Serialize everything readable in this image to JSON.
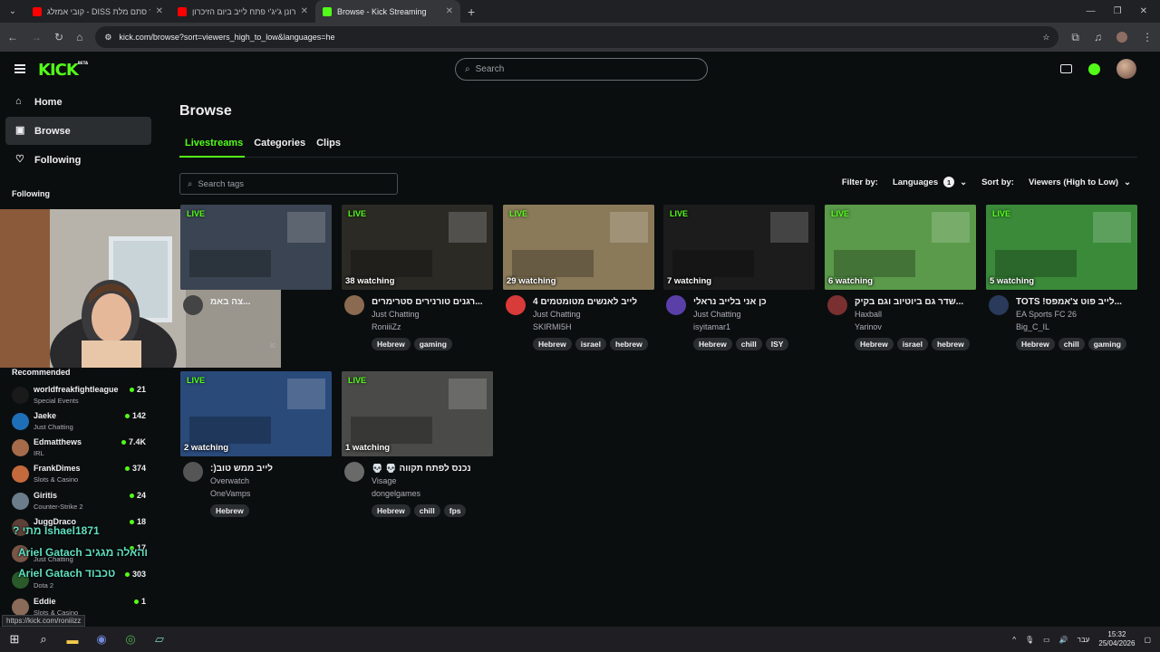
{
  "browser": {
    "tabs": [
      {
        "title": "קובי אמזלג - DISS עוד סתם מלת",
        "color": "#ff0000"
      },
      {
        "title": "רונן ג'יג'י פתח לייב ביום הזיכרון",
        "color": "#ff0000"
      },
      {
        "title": "Browse - Kick Streaming",
        "color": "#53fc18"
      }
    ],
    "new_tab": "+",
    "url": "kick.com/browse?sort=viewers_high_to_low&languages=he",
    "status_url": "https://kick.com/roniiizz"
  },
  "header": {
    "logo": "KICK",
    "logo_sup": "BETA",
    "search_placeholder": "Search"
  },
  "sidebar": {
    "nav": [
      {
        "label": "Home",
        "icon": "home-icon"
      },
      {
        "label": "Browse",
        "icon": "browse-icon"
      },
      {
        "label": "Following",
        "icon": "heart-icon"
      }
    ],
    "following_heading": "Following",
    "recommended_heading": "Recommended",
    "recommended": [
      {
        "name": "worldfreakfightleague",
        "category": "Special Events",
        "count": "21",
        "color": "#1a1a1a"
      },
      {
        "name": "Jaeke",
        "category": "Just Chatting",
        "count": "142",
        "color": "#1e6fb8"
      },
      {
        "name": "Edmatthews",
        "category": "IRL",
        "count": "7.4K",
        "color": "#a56b4a"
      },
      {
        "name": "FrankDimes",
        "category": "Slots & Casino",
        "count": "374",
        "color": "#c46a3c"
      },
      {
        "name": "Giritis",
        "category": "Counter-Strike 2",
        "count": "24",
        "color": "#6b7c8a"
      },
      {
        "name": "JuggDraco",
        "category": "",
        "count": "18",
        "color": "#5d4037"
      },
      {
        "name": "",
        "category": "Just Chatting",
        "count": "17",
        "color": "#7a5548"
      },
      {
        "name": "",
        "category": "Dota 2",
        "count": "303",
        "color": "#2a5a2a"
      },
      {
        "name": "Eddie",
        "category": "Slots & Casino",
        "count": "1",
        "color": "#8a6a58"
      }
    ]
  },
  "chat_overlay": [
    {
      "text": "? מתי Ishael1871",
      "color": "#5fe0c0"
    },
    {
      "text": "Ariel Gatach והאלה מגגיב",
      "color": "#5fe0c0"
    },
    {
      "text": "Ariel Gatach טכבוד",
      "color": "#5fe0c0"
    }
  ],
  "main": {
    "title": "Browse",
    "tabs": [
      "Livestreams",
      "Categories",
      "Clips"
    ],
    "tags_placeholder": "Search tags",
    "filter_label": "Filter by:",
    "languages_label": "Languages",
    "languages_count": "1",
    "sort_label": "Sort by:",
    "sort_value": "Viewers (High to Low)"
  },
  "streams": [
    {
      "live": "LIVE",
      "watching": "",
      "title": "...צה באמ",
      "category": "",
      "user": "",
      "tags": [],
      "avatar": "#444",
      "thumb": "#3a4452",
      "partial": true,
      "extra": "ic"
    },
    {
      "live": "LIVE",
      "watching": "38 watching",
      "title": "...רגנים טורנירים סטרימרים",
      "category": "Just Chatting",
      "user": "RoniiiZz",
      "tags": [
        "Hebrew",
        "gaming"
      ],
      "avatar": "#8a6a50",
      "thumb": "#2b2a25"
    },
    {
      "live": "LIVE",
      "watching": "29 watching",
      "title": "לייב לאנשים מטומטמים 4",
      "category": "Just Chatting",
      "user": "SKIRMI5H",
      "tags": [
        "Hebrew",
        "israel",
        "hebrew"
      ],
      "avatar": "#d93a3a",
      "thumb": "#8a7a5a"
    },
    {
      "live": "LIVE",
      "watching": "7 watching",
      "title": "כן אני בלייב נראלי",
      "category": "Just Chatting",
      "user": "isyitamar1",
      "tags": [
        "Hebrew",
        "chill",
        "ISY"
      ],
      "avatar": "#5a3fa8",
      "thumb": "#1c1c1c"
    },
    {
      "live": "LIVE",
      "watching": "6 watching",
      "title": "...שדר גם ביוטיוב וגם בקיק",
      "category": "Haxball",
      "user": "Yarinov",
      "tags": [
        "Hebrew",
        "israel",
        "hebrew"
      ],
      "avatar": "#7a3030",
      "thumb": "#5a9a4a"
    },
    {
      "live": "LIVE",
      "watching": "5 watching",
      "title": "...לייב פוט צ'אמפס! TOTS",
      "category": "EA Sports FC 26",
      "user": "Big_C_IL",
      "tags": [
        "Hebrew",
        "chill",
        "gaming"
      ],
      "avatar": "#2a3a5a",
      "thumb": "#3a8a3a"
    },
    {
      "live": "LIVE",
      "watching": "2 watching",
      "title": "לייב ממש טוב(:",
      "category": "Overwatch",
      "user": "OneVamps",
      "tags": [
        "Hebrew"
      ],
      "avatar": "#555555",
      "thumb": "#2a4a7a"
    },
    {
      "live": "LIVE",
      "watching": "1 watching",
      "title": "נכנס לפתח תקווה 💀 💀",
      "category": "Visage",
      "user": "dongelgames",
      "tags": [
        "Hebrew",
        "chill",
        "fps"
      ],
      "avatar": "#6a6a6a",
      "thumb": "#4a4a48"
    }
  ],
  "taskbar": {
    "lang": "עבר",
    "time": "15:32",
    "date": "25/04/2026"
  }
}
